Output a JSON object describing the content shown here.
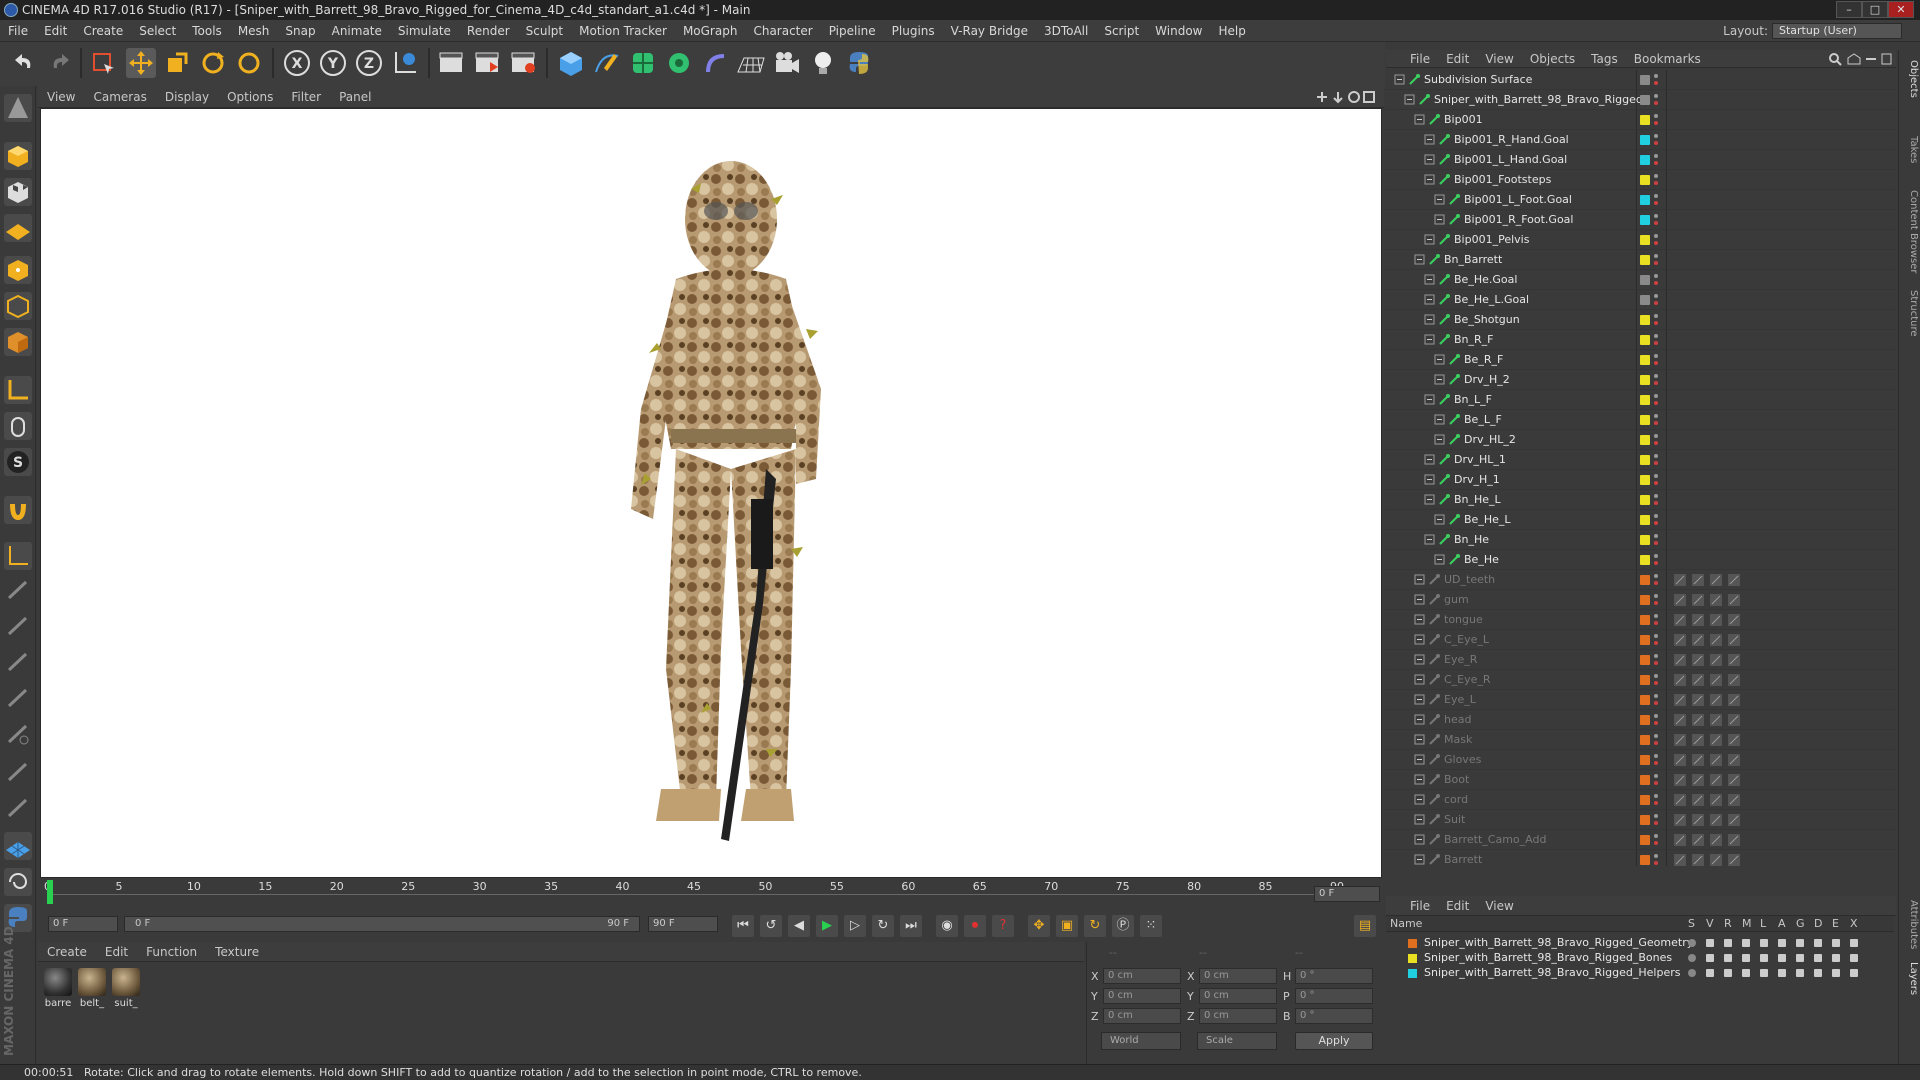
{
  "window": {
    "title": "CINEMA 4D R17.016 Studio (R17) - [Sniper_with_Barrett_98_Bravo_Rigged_for_Cinema_4D_c4d_standart_a1.c4d *] - Main",
    "controls": [
      "–",
      "□",
      "✕"
    ]
  },
  "menubar": {
    "items": [
      "File",
      "Edit",
      "Create",
      "Select",
      "Tools",
      "Mesh",
      "Snap",
      "Animate",
      "Simulate",
      "Render",
      "Sculpt",
      "Motion Tracker",
      "MoGraph",
      "Character",
      "Pipeline",
      "Plugins",
      "V-Ray Bridge",
      "3DToAll",
      "Script",
      "Window",
      "Help"
    ],
    "layout_label": "Layout:",
    "layout_value": "Startup (User)"
  },
  "viewport": {
    "menu": [
      "View",
      "Cameras",
      "Display",
      "Options",
      "Filter",
      "Panel"
    ]
  },
  "timeline": {
    "ticks": [
      "0",
      "5",
      "10",
      "15",
      "20",
      "25",
      "30",
      "35",
      "40",
      "45",
      "50",
      "55",
      "60",
      "65",
      "70",
      "75",
      "80",
      "85",
      "90"
    ],
    "current_frame": "0 F",
    "start_field": "0 F",
    "range_start": "0 F",
    "range_end": "90 F",
    "end_field": "90 F"
  },
  "materials": {
    "menu": [
      "Create",
      "Edit",
      "Function",
      "Texture"
    ],
    "items": [
      "barre",
      "belt_",
      "suit_"
    ]
  },
  "coordinates": {
    "headers": [
      "--",
      "--",
      "--"
    ],
    "rows": [
      {
        "a": "X",
        "av": "0 cm",
        "b": "X",
        "bv": "0 cm",
        "c": "H",
        "cv": "0 °"
      },
      {
        "a": "Y",
        "av": "0 cm",
        "b": "Y",
        "bv": "0 cm",
        "c": "P",
        "cv": "0 °"
      },
      {
        "a": "Z",
        "av": "0 cm",
        "b": "Z",
        "bv": "0 cm",
        "c": "B",
        "cv": "0 °"
      }
    ],
    "space": "World",
    "mode": "Scale",
    "apply": "Apply"
  },
  "status": {
    "time": "00:00:51",
    "message": "Rotate: Click and drag to rotate elements. Hold down SHIFT to add to quantize rotation / add to the selection in point mode, CTRL to remove."
  },
  "object_manager": {
    "menu": [
      "File",
      "Edit",
      "View",
      "Objects",
      "Tags",
      "Bookmarks"
    ],
    "objects": [
      {
        "name": "Subdivision Surface",
        "indent": 0,
        "tag": "#8a8a8a",
        "dim": false
      },
      {
        "name": "Sniper_with_Barrett_98_Bravo_Rigged",
        "indent": 1,
        "tag": "#8a8a8a",
        "dim": false
      },
      {
        "name": "Bip001",
        "indent": 2,
        "tag": "#e8e020",
        "dim": false
      },
      {
        "name": "Bip001_R_Hand.Goal",
        "indent": 3,
        "tag": "#20d0e0",
        "dim": false
      },
      {
        "name": "Bip001_L_Hand.Goal",
        "indent": 3,
        "tag": "#20d0e0",
        "dim": false
      },
      {
        "name": "Bip001_Footsteps",
        "indent": 3,
        "tag": "#e8e020",
        "dim": false
      },
      {
        "name": "Bip001_L_Foot.Goal",
        "indent": 4,
        "tag": "#20d0e0",
        "dim": false
      },
      {
        "name": "Bip001_R_Foot.Goal",
        "indent": 4,
        "tag": "#20d0e0",
        "dim": false
      },
      {
        "name": "Bip001_Pelvis",
        "indent": 3,
        "tag": "#e8e020",
        "dim": false
      },
      {
        "name": "Bn_Barrett",
        "indent": 2,
        "tag": "#e8e020",
        "dim": false
      },
      {
        "name": "Be_He.Goal",
        "indent": 3,
        "tag": "#8a8a8a",
        "dim": false
      },
      {
        "name": "Be_He_L.Goal",
        "indent": 3,
        "tag": "#8a8a8a",
        "dim": false
      },
      {
        "name": "Be_Shotgun",
        "indent": 3,
        "tag": "#e8e020",
        "dim": false
      },
      {
        "name": "Bn_R_F",
        "indent": 3,
        "tag": "#e8e020",
        "dim": false
      },
      {
        "name": "Be_R_F",
        "indent": 4,
        "tag": "#e8e020",
        "dim": false
      },
      {
        "name": "Drv_H_2",
        "indent": 4,
        "tag": "#e8e020",
        "dim": false
      },
      {
        "name": "Bn_L_F",
        "indent": 3,
        "tag": "#e8e020",
        "dim": false
      },
      {
        "name": "Be_L_F",
        "indent": 4,
        "tag": "#e8e020",
        "dim": false
      },
      {
        "name": "Drv_HL_2",
        "indent": 4,
        "tag": "#e8e020",
        "dim": false
      },
      {
        "name": "Drv_HL_1",
        "indent": 3,
        "tag": "#e8e020",
        "dim": false
      },
      {
        "name": "Drv_H_1",
        "indent": 3,
        "tag": "#e8e020",
        "dim": false
      },
      {
        "name": "Bn_He_L",
        "indent": 3,
        "tag": "#e8e020",
        "dim": false
      },
      {
        "name": "Be_He_L",
        "indent": 4,
        "tag": "#e8e020",
        "dim": false
      },
      {
        "name": "Bn_He",
        "indent": 3,
        "tag": "#e8e020",
        "dim": false
      },
      {
        "name": "Be_He",
        "indent": 4,
        "tag": "#e8e020",
        "dim": false
      },
      {
        "name": "UD_teeth",
        "indent": 2,
        "tag": "#e07020",
        "dim": true
      },
      {
        "name": "gum",
        "indent": 2,
        "tag": "#e07020",
        "dim": true
      },
      {
        "name": "tongue",
        "indent": 2,
        "tag": "#e07020",
        "dim": true
      },
      {
        "name": "C_Eye_L",
        "indent": 2,
        "tag": "#e07020",
        "dim": true
      },
      {
        "name": "Eye_R",
        "indent": 2,
        "tag": "#e07020",
        "dim": true
      },
      {
        "name": "C_Eye_R",
        "indent": 2,
        "tag": "#e07020",
        "dim": true
      },
      {
        "name": "Eye_L",
        "indent": 2,
        "tag": "#e07020",
        "dim": true
      },
      {
        "name": "head",
        "indent": 2,
        "tag": "#e07020",
        "dim": true
      },
      {
        "name": "Mask",
        "indent": 2,
        "tag": "#e07020",
        "dim": true
      },
      {
        "name": "Gloves",
        "indent": 2,
        "tag": "#e07020",
        "dim": true
      },
      {
        "name": "Boot",
        "indent": 2,
        "tag": "#e07020",
        "dim": true
      },
      {
        "name": "cord",
        "indent": 2,
        "tag": "#e07020",
        "dim": true
      },
      {
        "name": "Suit",
        "indent": 2,
        "tag": "#e07020",
        "dim": true
      },
      {
        "name": "Barrett_Camo_Add",
        "indent": 2,
        "tag": "#e07020",
        "dim": true
      },
      {
        "name": "Barrett",
        "indent": 2,
        "tag": "#e07020",
        "dim": true
      }
    ]
  },
  "layer_manager": {
    "menu": [
      "File",
      "Edit",
      "View"
    ],
    "columns": [
      "Name",
      "S",
      "V",
      "R",
      "M",
      "L",
      "A",
      "G",
      "D",
      "E",
      "X"
    ],
    "layers": [
      {
        "name": "Sniper_with_Barrett_98_Bravo_Rigged_Geometry",
        "color": "#e07020"
      },
      {
        "name": "Sniper_with_Barrett_98_Bravo_Rigged_Bones",
        "color": "#e8e020"
      },
      {
        "name": "Sniper_with_Barrett_98_Bravo_Rigged_Helpers",
        "color": "#20d0e0"
      }
    ]
  },
  "right_tabs": [
    "Objects",
    "Takes",
    "Content Browser",
    "Structure",
    "Attributes",
    "Layers"
  ],
  "brand": "MAXON CINEMA 4D"
}
